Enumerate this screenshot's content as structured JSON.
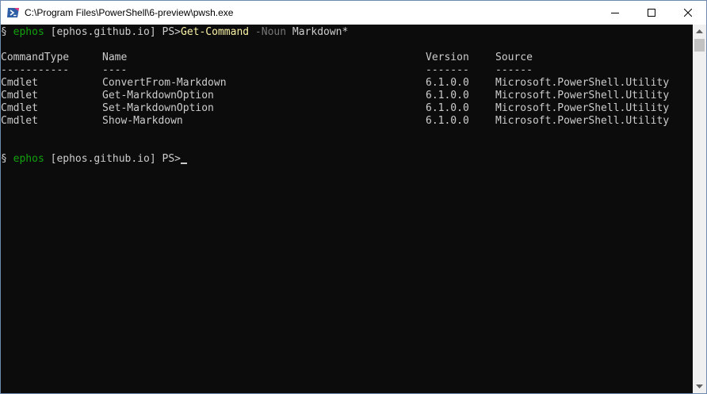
{
  "window": {
    "title": "C:\\Program Files\\PowerShell\\6-preview\\pwsh.exe",
    "icon": "powershell-icon"
  },
  "caption_buttons": [
    {
      "name": "minimize",
      "icon": "minimize-icon"
    },
    {
      "name": "maximize",
      "icon": "maximize-icon"
    },
    {
      "name": "close",
      "icon": "close-icon"
    }
  ],
  "colors": {
    "console_bg": "#0c0c0c",
    "text": "#cccccc",
    "prompt_user": "#13a10e",
    "command": "#f9f1a5",
    "parameter": "#767676"
  },
  "console": {
    "prompt1": {
      "symbol": "§",
      "user": "ephos",
      "host": "[ephos.github.io]",
      "ps": "PS>",
      "command": "Get-Command",
      "parameter": "-Noun",
      "argument": "Markdown*"
    },
    "table": {
      "headers": [
        "CommandType",
        "Name",
        "Version",
        "Source"
      ],
      "underlines": [
        "-----------",
        "----",
        "-------",
        "------"
      ],
      "rows": [
        [
          "Cmdlet",
          "ConvertFrom-Markdown",
          "6.1.0.0",
          "Microsoft.PowerShell.Utility"
        ],
        [
          "Cmdlet",
          "Get-MarkdownOption",
          "6.1.0.0",
          "Microsoft.PowerShell.Utility"
        ],
        [
          "Cmdlet",
          "Set-MarkdownOption",
          "6.1.0.0",
          "Microsoft.PowerShell.Utility"
        ],
        [
          "Cmdlet",
          "Show-Markdown",
          "6.1.0.0",
          "Microsoft.PowerShell.Utility"
        ]
      ]
    },
    "prompt2": {
      "symbol": "§",
      "user": "ephos",
      "host": "[ephos.github.io]",
      "ps": "PS>"
    }
  },
  "scrollbar": {
    "up_icon": "scroll-up-arrow-icon",
    "down_icon": "scroll-down-arrow-icon"
  }
}
